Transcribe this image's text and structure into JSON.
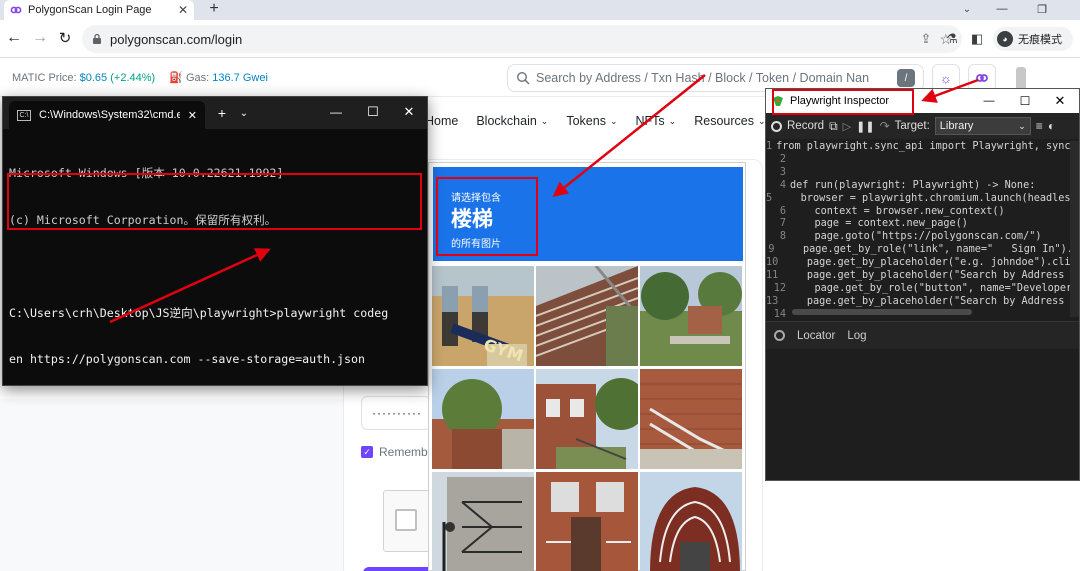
{
  "browser": {
    "tab_title": "PolygonScan Login Page",
    "url": "polygonscan.com/login",
    "incognito_label": "无痕模式"
  },
  "site": {
    "matic_label": "MATIC Price:",
    "matic_price": "$0.65",
    "matic_change": "(+2.44%)",
    "gas_label": "Gas:",
    "gas_value": "136.7 Gwei",
    "search_placeholder": "Search by Address / Txn Hash / Block / Token / Domain Nan",
    "search_shortcut": "/",
    "nav": [
      "Home",
      "Blockchain",
      "Tokens",
      "NFTs",
      "Resources"
    ],
    "password_mask": "··········",
    "remember_label": "Rememb",
    "brand_color": "#6e44ff"
  },
  "captcha": {
    "line1": "请选择包含",
    "keyword": "楼梯",
    "line3": "的所有图片",
    "header_color": "#1a73e8"
  },
  "cmd": {
    "tab_title": "C:\\Windows\\System32\\cmd.e",
    "lines": [
      "Microsoft Windows [版本 10.0.22621.1992]",
      "(c) Microsoft Corporation。保留所有权利。",
      "",
      "C:\\Users\\crh\\Desktop\\JS逆向\\playwright>playwright codeg",
      "en https://polygonscan.com --save-storage=auth.json"
    ]
  },
  "inspector": {
    "title": "Playwright Inspector",
    "record_label": "Record",
    "target_label": "Target:",
    "target_value": "Library",
    "tab_locator": "Locator",
    "tab_log": "Log",
    "code_lines": [
      "from playwright.sync_api import Playwright, sync_p",
      "",
      "",
      "def run(playwright: Playwright) -> None:",
      "    browser = playwright.chromium.launch(headless=",
      "    context = browser.new_context()",
      "    page = context.new_page()",
      "    page.goto(\"https://polygonscan.com/\")",
      "    page.get_by_role(\"link\", name=\"   Sign In\").c",
      "    page.get_by_placeholder(\"e.g. johndoe\").click",
      "    page.get_by_placeholder(\"Search by Address / T",
      "    page.get_by_role(\"button\", name=\"Developers",
      "    page.get_by_placeholder(\"Search by Address / T",
      ""
    ]
  },
  "annotation_color": "#e0000f"
}
